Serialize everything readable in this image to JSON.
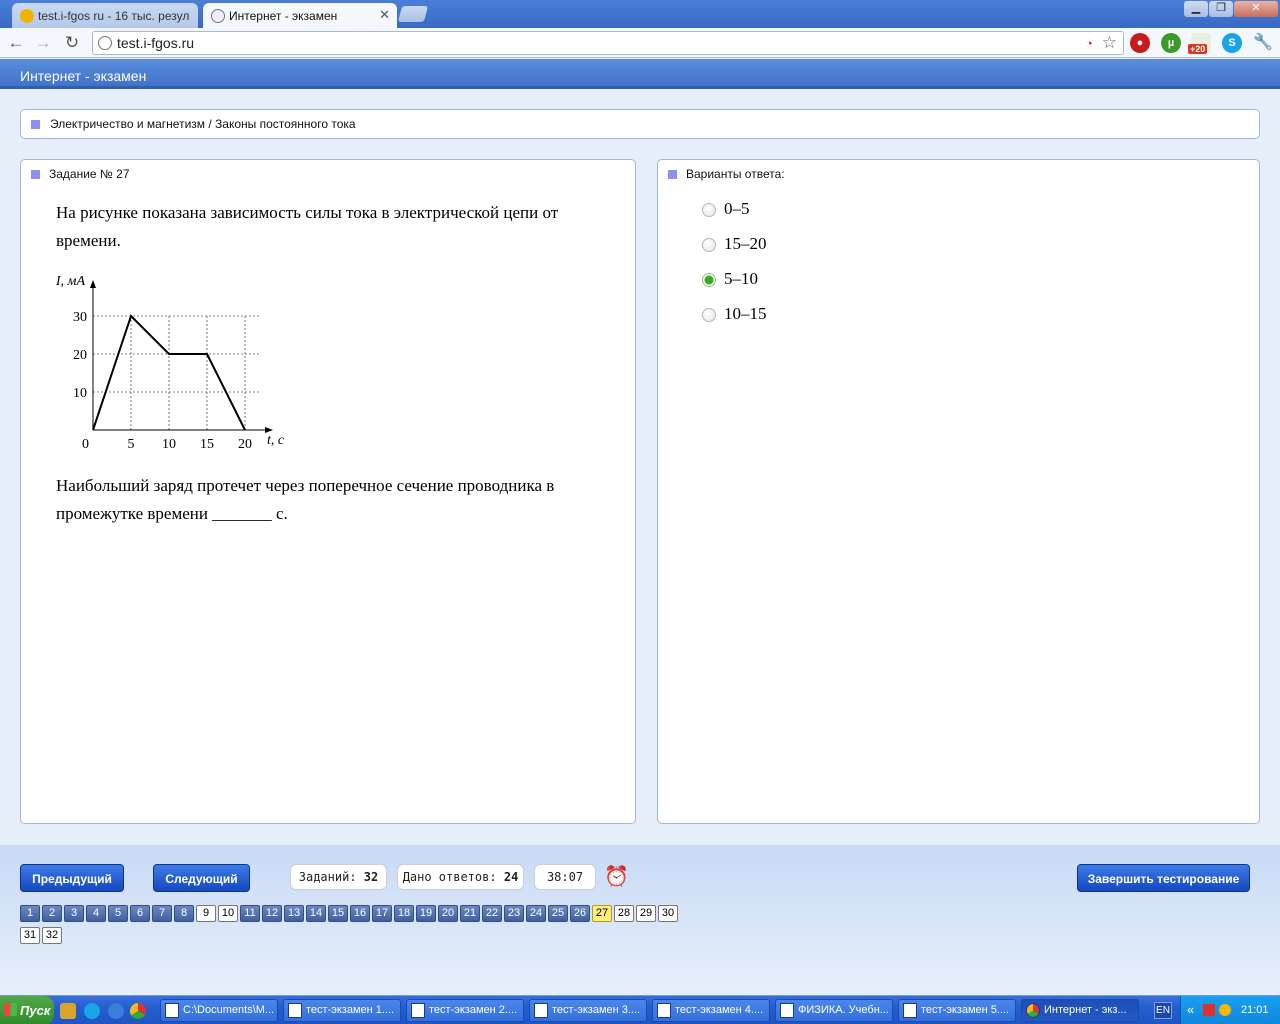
{
  "browser": {
    "tabs": [
      {
        "title": "test.i-fgos ru - 16 тыс. резул",
        "active": false
      },
      {
        "title": "Интернет - экзамен",
        "active": true
      }
    ],
    "address": "test.i-fgos.ru",
    "badge": "+20",
    "window_buttons": {
      "minimize": "▁",
      "maximize": "❐",
      "close": "✕"
    }
  },
  "app": {
    "title": "Интернет - экзамен",
    "breadcrumb": "Электричество и магнетизм / Законы постоянного тока"
  },
  "question": {
    "label": "Задание № 27",
    "text1": "На рисунке показана зависимость силы тока в электрической цепи от времени.",
    "text2": "Наибольший заряд протечет через поперечное сечение проводника  в промежутке времени _______ c."
  },
  "chart_data": {
    "type": "line",
    "x": [
      0,
      5,
      10,
      15,
      20
    ],
    "series": [
      {
        "values": [
          0,
          30,
          20,
          20,
          0
        ]
      }
    ],
    "xlabel": "t, с",
    "ylabel": "I, мА",
    "xticks": [
      "0",
      "5",
      "10",
      "15",
      "20"
    ],
    "yticks": [
      "10",
      "20",
      "30"
    ],
    "xlim": [
      0,
      20
    ],
    "ylim": [
      0,
      30
    ],
    "grid": true
  },
  "answers": {
    "label": "Варианты ответа:",
    "options": [
      {
        "text": "0–5",
        "checked": false
      },
      {
        "text": "15–20",
        "checked": false
      },
      {
        "text": "5–10",
        "checked": true
      },
      {
        "text": "10–15",
        "checked": false
      }
    ]
  },
  "footer": {
    "prev_label": "Предыдущий",
    "next_label": "Следующий",
    "tasks_label": "Заданий:",
    "tasks_value": "32",
    "answered_label": "Дано ответов:",
    "answered_value": "24",
    "timer": "38:07",
    "finish_label": "Завершить тестирование",
    "question_numbers": {
      "done": [
        1,
        2,
        3,
        4,
        5,
        6,
        7,
        8,
        11,
        12,
        13,
        14,
        15,
        16,
        17,
        18,
        19,
        20,
        21,
        22,
        23,
        24,
        25,
        26
      ],
      "current": 27,
      "total": 32
    }
  },
  "taskbar": {
    "start_label": "Пуск",
    "items": [
      {
        "label": "C:\\Documents\\M...",
        "active": false
      },
      {
        "label": "тест-экзамен 1....",
        "active": false
      },
      {
        "label": "тест-экзамен 2....",
        "active": false
      },
      {
        "label": "тест-экзамен 3....",
        "active": false
      },
      {
        "label": "тест-экзамен 4....",
        "active": false
      },
      {
        "label": "ФИЗИКА. Учебн...",
        "active": false
      },
      {
        "label": "тест-экзамен 5....",
        "active": false
      },
      {
        "label": "Интернет - экз...",
        "active": true
      }
    ],
    "lang": "EN",
    "time": "21:01"
  }
}
